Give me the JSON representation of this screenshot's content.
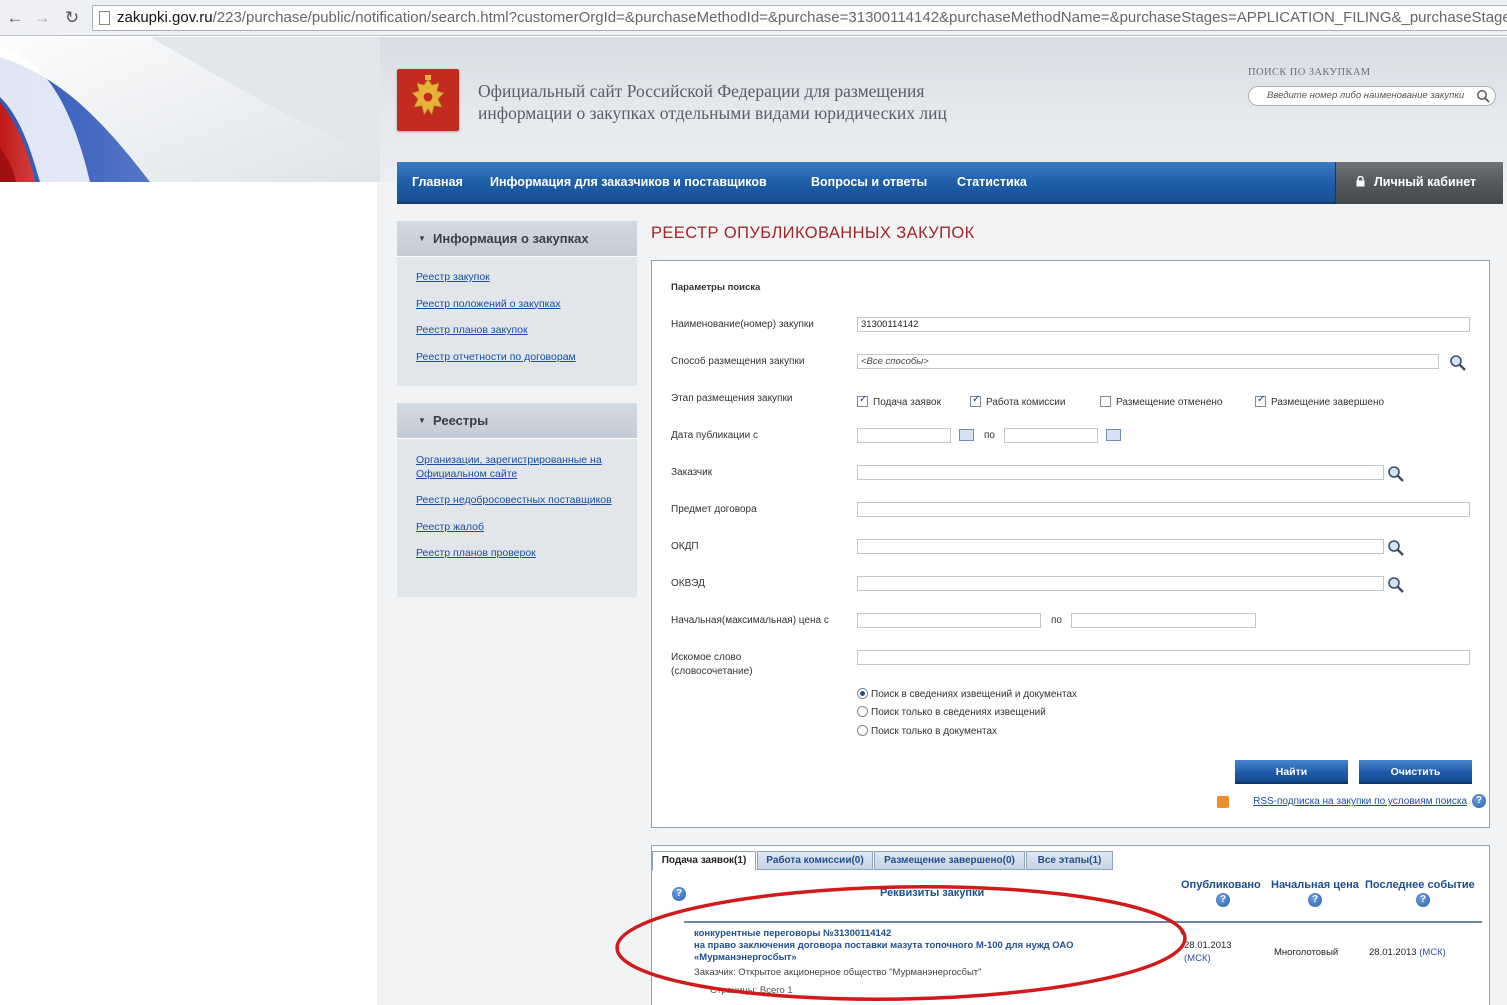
{
  "browser": {
    "url_domain": "zakupki.gov.ru",
    "url_path": "/223/purchase/public/notification/search.html?customerOrgId=&purchaseMethodId=&purchase=31300114142&purchaseMethodName=&purchaseStages=APPLICATION_FILING&_purchaseStages",
    "back_icon": "arrow-left-icon",
    "forward_icon": "arrow-right-icon",
    "reload_icon": "reload-icon"
  },
  "header": {
    "title_line1": "Официальный сайт Российской Федерации для размещения",
    "title_line2": "информации о закупках отдельными видами юридических лиц",
    "search_label": "ПОИСК ПО ЗАКУПКАМ",
    "search_placeholder": "Введите номер либо наименование закупки"
  },
  "topnav": {
    "items": [
      "Главная",
      "Информация для заказчиков и поставщиков",
      "Вопросы и ответы",
      "Статистика"
    ],
    "cabinet": "Личный кабинет"
  },
  "sidebar": {
    "box1": {
      "title": "Информация о закупках",
      "links": [
        "Реестр закупок",
        "Реестр положений о закупках",
        "Реестр планов закупок",
        "Реестр отчетности по договорам"
      ]
    },
    "box2": {
      "title": "Реестры",
      "links": [
        "Организации, зарегистрированные на Официальном сайте",
        "Реестр недобросовестных поставщиков",
        "Реестр жалоб",
        "Реестр планов проверок"
      ]
    }
  },
  "main": {
    "title": "РЕЕСТР ОПУБЛИКОВАННЫХ ЗАКУПОК",
    "form": {
      "heading": "Параметры поиска",
      "name_label": "Наименование(номер) закупки",
      "name_value": "31300114142",
      "method_label": "Способ размещения закупки",
      "method_value": "<Все способы>",
      "stage_label": "Этап размещения закупки",
      "stages": [
        {
          "label": "Подача заявок",
          "checked": true
        },
        {
          "label": "Работа комиссии",
          "checked": true
        },
        {
          "label": "Размещение отменено",
          "checked": false
        },
        {
          "label": "Размещение завершено",
          "checked": true
        }
      ],
      "date_label": "Дата публикации с",
      "date_to": "по",
      "customer_label": "Заказчик",
      "subject_label": "Предмет договора",
      "okdp_label": "ОКДП",
      "okved_label": "ОКВЭД",
      "price_label": "Начальная(максимальная) цена с",
      "price_to": "по",
      "keyword_label_1": "Искомое слово",
      "keyword_label_2": "(словосочетание)",
      "search_modes": [
        {
          "label": "Поиск в сведениях извещений и документах",
          "selected": true
        },
        {
          "label": "Поиск только в сведениях извещений",
          "selected": false
        },
        {
          "label": "Поиск только в документах",
          "selected": false
        }
      ],
      "find_button": "Найти",
      "clear_button": "Очистить",
      "rss_link": "RSS-подписка на закупки по условиям поиска"
    },
    "results": {
      "tabs": [
        "Подача заявок(1)",
        "Работа комиссии(0)",
        "Размещение завершено(0)",
        "Все этапы(1)"
      ],
      "columns": {
        "requisites": "Реквизиты закупки",
        "published": "Опубликовано",
        "price": "Начальная цена",
        "last_event": "Последнее событие"
      },
      "row": {
        "line1": "конкурентные переговоры  №31300114142",
        "line2": "на право заключения договора поставки мазута топочного М-100 для нужд ОАО",
        "line3": "«Мурманэнергосбыт»",
        "customer": "Заказчик:  Открытое акционерное общество \"Мурманэнергосбыт\"",
        "published_date": "28.01.2013",
        "published_tz": "(МСК)",
        "price": "Многолотовый",
        "last_event_date": "28.01.2013",
        "last_event_tz": "(МСК)"
      },
      "footer": "Страницы: Всего 1"
    }
  },
  "colors": {
    "nav_blue": "#1f5fa8",
    "title_red": "#a02828",
    "link_blue": "#1a4fa0",
    "annotation_red": "#d11a1a"
  }
}
